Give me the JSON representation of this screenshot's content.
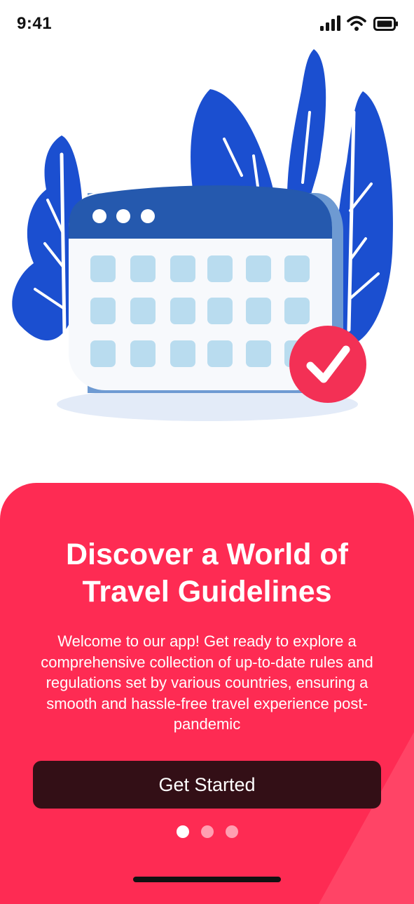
{
  "status_bar": {
    "time": "9:41",
    "icons": [
      "signal-icon",
      "wifi-icon",
      "battery-icon"
    ]
  },
  "illustration": {
    "subject": "calendar-with-checkmark-illustration",
    "colors": {
      "leaves": "#1b4fd0",
      "calendar_header": "#2559ae",
      "calendar_body": "#f7f9fc",
      "day_cells": "#b9dcef",
      "checkmark_badge": "#f33055",
      "shadow": "#e3ebf8"
    }
  },
  "onboarding": {
    "title": "Discover a World of Travel Guidelines",
    "description": "Welcome to our app! Get ready to explore a comprehensive collection of up-to-date rules and regulations set by various countries, ensuring a smooth and hassle-free travel experience post-pandemic",
    "cta_label": "Get Started",
    "page_indicator": {
      "total": 3,
      "current": 1
    }
  },
  "theme": {
    "accent": "#fe2b53",
    "button_bg": "#330f16",
    "text_on_accent": "#ffffff"
  }
}
